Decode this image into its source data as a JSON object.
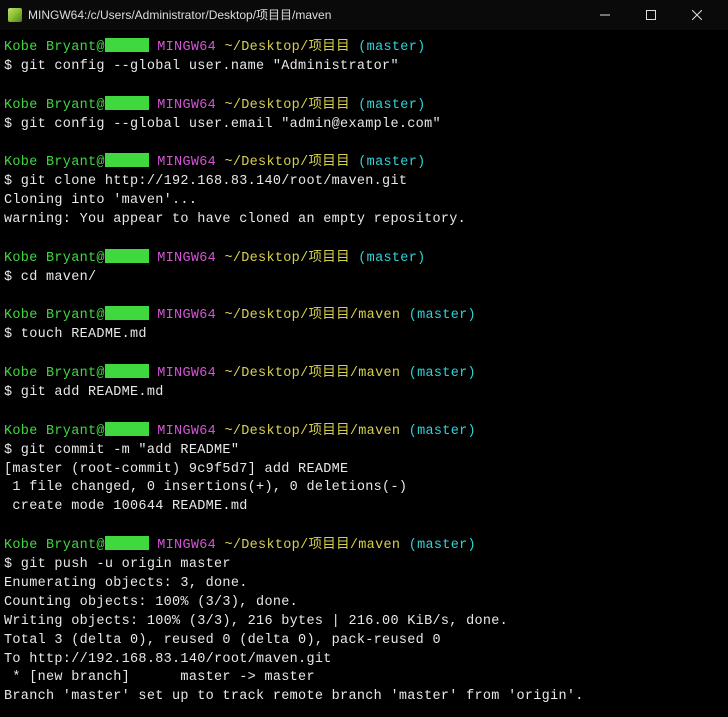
{
  "window": {
    "title": "MINGW64:/c/Users/Administrator/Desktop/项目目/maven"
  },
  "prompt": {
    "user": "Kobe Bryant@",
    "env": "MINGW64",
    "path1": "~/Desktop/项目目",
    "path2": "~/Desktop/项目目/maven",
    "branch": "(master)"
  },
  "cmd": {
    "cfg_name": "$ git config --global user.name \"Administrator\"",
    "cfg_email": "$ git config --global user.email \"admin@example.com\"",
    "clone": "$ git clone http://192.168.83.140/root/maven.git",
    "cd": "$ cd maven/",
    "touch": "$ touch README.md",
    "add": "$ git add README.md",
    "commit": "$ git commit -m \"add README\"",
    "push": "$ git push -u origin master"
  },
  "out": {
    "cloning": "Cloning into 'maven'...",
    "warn_empty": "warning: You appear to have cloned an empty repository.",
    "commit_head": "[master (root-commit) 9c9f5d7] add README",
    "commit_stats": " 1 file changed, 0 insertions(+), 0 deletions(-)",
    "commit_create": " create mode 100644 README.md",
    "push_enum": "Enumerating objects: 3, done.",
    "push_count": "Counting objects: 100% (3/3), done.",
    "push_write": "Writing objects: 100% (3/3), 216 bytes | 216.00 KiB/s, done.",
    "push_total": "Total 3 (delta 0), reused 0 (delta 0), pack-reused 0",
    "push_to": "To http://192.168.83.140/root/maven.git",
    "push_newbranch": " * [new branch]      master -> master",
    "push_track": "Branch 'master' set up to track remote branch 'master' from 'origin'."
  }
}
